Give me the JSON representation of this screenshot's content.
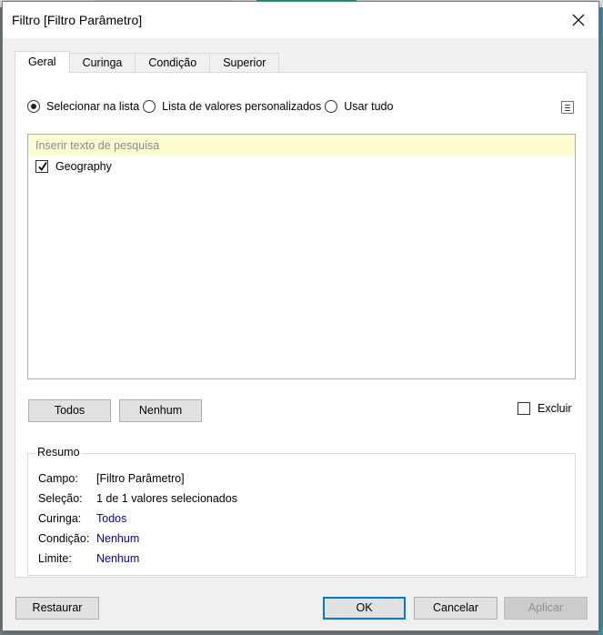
{
  "window": {
    "title": "Filtro [Filtro Parâmetro]"
  },
  "tabs": [
    {
      "label": "Geral",
      "active": true
    },
    {
      "label": "Curinga",
      "active": false
    },
    {
      "label": "Condição",
      "active": false
    },
    {
      "label": "Superior",
      "active": false
    }
  ],
  "general": {
    "radios": [
      {
        "label": "Selecionar na lista",
        "selected": true
      },
      {
        "label": "Lista de valores personalizados",
        "selected": false
      },
      {
        "label": "Usar tudo",
        "selected": false
      }
    ],
    "search": {
      "placeholder": "Inserir texto de pesquisa",
      "value": ""
    },
    "list_items": [
      {
        "label": "Geography",
        "checked": true
      }
    ],
    "buttons": {
      "all": "Todos",
      "none": "Nenhum"
    },
    "exclude": {
      "label": "Excluir",
      "checked": false
    }
  },
  "summary": {
    "legend": "Resumo",
    "rows": [
      {
        "label": "Campo:",
        "value": "[Filtro Parâmetro]",
        "link": false
      },
      {
        "label": "Seleção:",
        "value": "1 de 1 valores selecionados",
        "link": false
      },
      {
        "label": "Curinga:",
        "value": "Todos",
        "link": true
      },
      {
        "label": "Condição:",
        "value": "Nenhum",
        "link": true
      },
      {
        "label": "Limite:",
        "value": "Nenhum",
        "link": true
      }
    ]
  },
  "footer": {
    "reset": "Restaurar",
    "ok": "OK",
    "cancel": "Cancelar",
    "apply": "Aplicar"
  },
  "colors": {
    "link": "#0000cc",
    "search_bg": "#fdfbd2",
    "primary_border": "#0078d7"
  }
}
